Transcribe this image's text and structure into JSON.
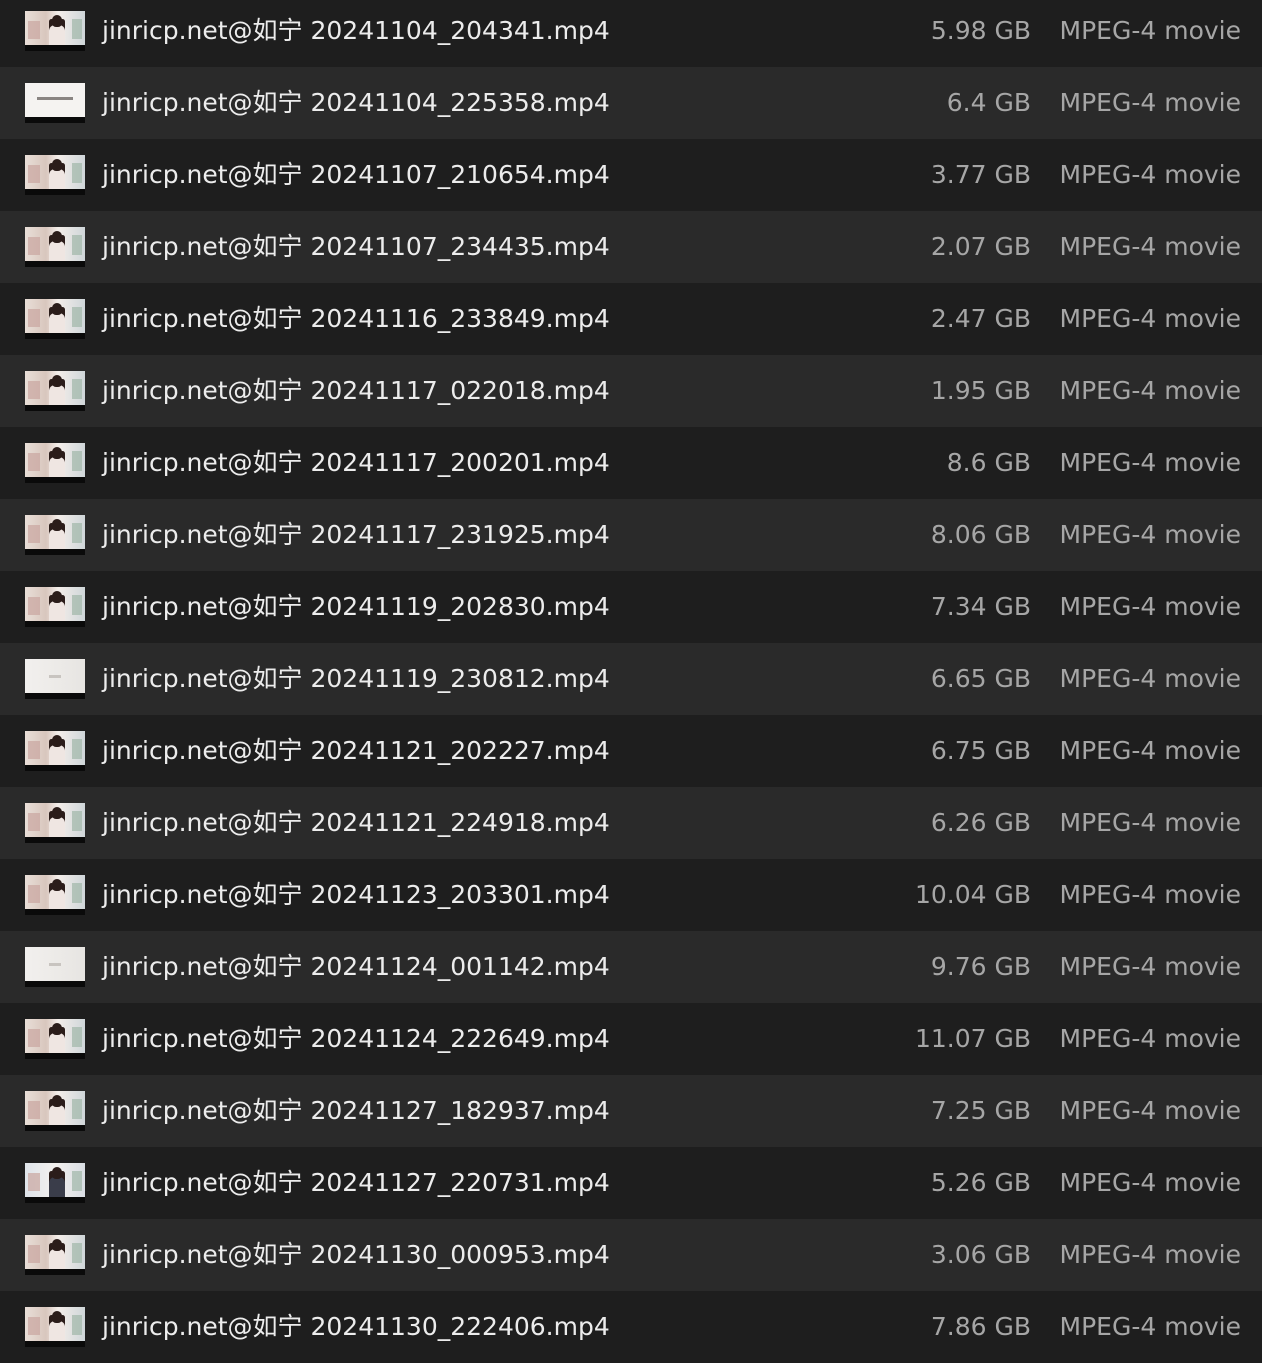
{
  "files": [
    {
      "name": "jinricp.net@如宁 20241104_204341.mp4",
      "size": "5.98 GB",
      "kind": "MPEG-4 movie",
      "thumb": "portrait"
    },
    {
      "name": "jinricp.net@如宁 20241104_225358.mp4",
      "size": "6.4 GB",
      "kind": "MPEG-4 movie",
      "thumb": "text"
    },
    {
      "name": "jinricp.net@如宁 20241107_210654.mp4",
      "size": "3.77 GB",
      "kind": "MPEG-4 movie",
      "thumb": "portrait"
    },
    {
      "name": "jinricp.net@如宁 20241107_234435.mp4",
      "size": "2.07 GB",
      "kind": "MPEG-4 movie",
      "thumb": "portrait"
    },
    {
      "name": "jinricp.net@如宁 20241116_233849.mp4",
      "size": "2.47 GB",
      "kind": "MPEG-4 movie",
      "thumb": "portrait"
    },
    {
      "name": "jinricp.net@如宁 20241117_022018.mp4",
      "size": "1.95 GB",
      "kind": "MPEG-4 movie",
      "thumb": "portrait"
    },
    {
      "name": "jinricp.net@如宁 20241117_200201.mp4",
      "size": "8.6 GB",
      "kind": "MPEG-4 movie",
      "thumb": "portrait"
    },
    {
      "name": "jinricp.net@如宁 20241117_231925.mp4",
      "size": "8.06 GB",
      "kind": "MPEG-4 movie",
      "thumb": "portrait"
    },
    {
      "name": "jinricp.net@如宁 20241119_202830.mp4",
      "size": "7.34 GB",
      "kind": "MPEG-4 movie",
      "thumb": "portrait"
    },
    {
      "name": "jinricp.net@如宁 20241119_230812.mp4",
      "size": "6.65 GB",
      "kind": "MPEG-4 movie",
      "thumb": "blank"
    },
    {
      "name": "jinricp.net@如宁 20241121_202227.mp4",
      "size": "6.75 GB",
      "kind": "MPEG-4 movie",
      "thumb": "portrait"
    },
    {
      "name": "jinricp.net@如宁 20241121_224918.mp4",
      "size": "6.26 GB",
      "kind": "MPEG-4 movie",
      "thumb": "portrait"
    },
    {
      "name": "jinricp.net@如宁 20241123_203301.mp4",
      "size": "10.04 GB",
      "kind": "MPEG-4 movie",
      "thumb": "portrait"
    },
    {
      "name": "jinricp.net@如宁 20241124_001142.mp4",
      "size": "9.76 GB",
      "kind": "MPEG-4 movie",
      "thumb": "blank"
    },
    {
      "name": "jinricp.net@如宁 20241124_222649.mp4",
      "size": "11.07 GB",
      "kind": "MPEG-4 movie",
      "thumb": "portrait"
    },
    {
      "name": "jinricp.net@如宁 20241127_182937.mp4",
      "size": "7.25 GB",
      "kind": "MPEG-4 movie",
      "thumb": "portrait"
    },
    {
      "name": "jinricp.net@如宁 20241127_220731.mp4",
      "size": "5.26 GB",
      "kind": "MPEG-4 movie",
      "thumb": "anime"
    },
    {
      "name": "jinricp.net@如宁 20241130_000953.mp4",
      "size": "3.06 GB",
      "kind": "MPEG-4 movie",
      "thumb": "portrait"
    },
    {
      "name": "jinricp.net@如宁 20241130_222406.mp4",
      "size": "7.86 GB",
      "kind": "MPEG-4 movie",
      "thumb": "portrait"
    }
  ]
}
